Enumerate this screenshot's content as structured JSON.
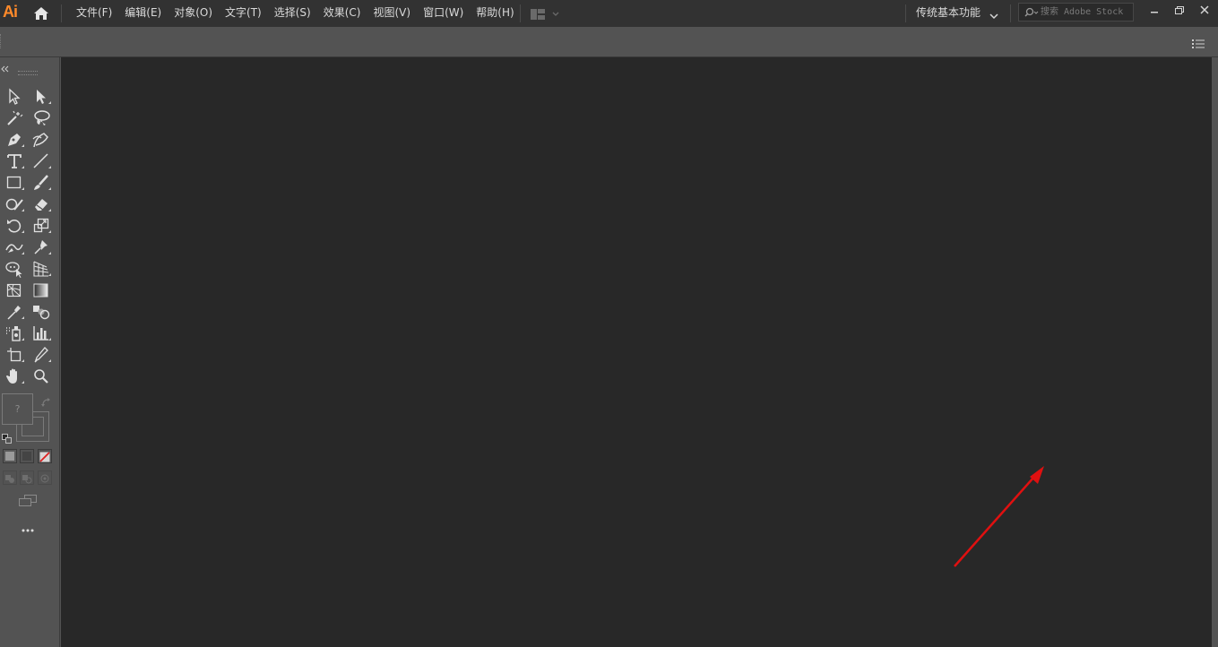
{
  "app": {
    "logo": "Ai"
  },
  "menu": [
    {
      "label": "文件(F)"
    },
    {
      "label": "编辑(E)"
    },
    {
      "label": "对象(O)"
    },
    {
      "label": "文字(T)"
    },
    {
      "label": "选择(S)"
    },
    {
      "label": "效果(C)"
    },
    {
      "label": "视图(V)"
    },
    {
      "label": "窗口(W)"
    },
    {
      "label": "帮助(H)"
    }
  ],
  "workspace": {
    "label": "传统基本功能"
  },
  "search": {
    "placeholder": "搜索 Adobe Stock"
  },
  "fill_stroke": {
    "fill_unknown_glyph": "?"
  },
  "colors": {
    "menubar_bg": "#323232",
    "panel_bg": "#535353",
    "canvas_bg": "#282828",
    "logo": "#ff8a2a",
    "annotation_arrow": "#e01010"
  },
  "tools": [
    {
      "icon": "selection-icon"
    },
    {
      "icon": "direct-selection-icon"
    },
    {
      "icon": "magic-wand-icon"
    },
    {
      "icon": "lasso-icon"
    },
    {
      "icon": "pen-icon"
    },
    {
      "icon": "curvature-icon"
    },
    {
      "icon": "type-icon"
    },
    {
      "icon": "line-segment-icon"
    },
    {
      "icon": "rectangle-icon"
    },
    {
      "icon": "paintbrush-icon"
    },
    {
      "icon": "shaper-icon"
    },
    {
      "icon": "eraser-icon"
    },
    {
      "icon": "rotate-icon"
    },
    {
      "icon": "scale-icon"
    },
    {
      "icon": "width-icon"
    },
    {
      "icon": "puppet-warp-icon"
    },
    {
      "icon": "shape-builder-icon"
    },
    {
      "icon": "perspective-grid-icon"
    },
    {
      "icon": "mesh-icon"
    },
    {
      "icon": "gradient-icon"
    },
    {
      "icon": "eyedropper-icon"
    },
    {
      "icon": "blend-icon"
    },
    {
      "icon": "symbol-sprayer-icon"
    },
    {
      "icon": "column-graph-icon"
    },
    {
      "icon": "artboard-icon"
    },
    {
      "icon": "slice-icon"
    },
    {
      "icon": "hand-icon"
    },
    {
      "icon": "zoom-icon"
    }
  ]
}
